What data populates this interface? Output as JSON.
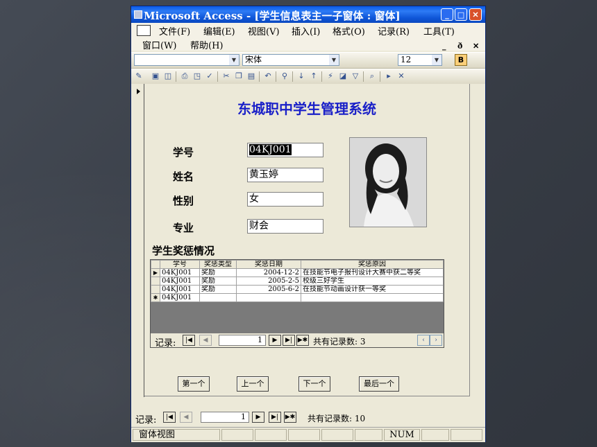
{
  "window": {
    "title": "Microsoft Access - [学生信息表主一子窗体 : 窗体]"
  },
  "menubar": {
    "items": [
      {
        "label": "文件(F)"
      },
      {
        "label": "编辑(E)"
      },
      {
        "label": "视图(V)"
      },
      {
        "label": "插入(I)"
      },
      {
        "label": "格式(O)"
      },
      {
        "label": "记录(R)"
      },
      {
        "label": "工具(T)"
      },
      {
        "label": "窗口(W)"
      },
      {
        "label": "帮助(H)"
      }
    ]
  },
  "format_toolbar": {
    "font": "宋体",
    "size": "12",
    "bold": "B"
  },
  "form": {
    "heading": "东城职中学生管理系统",
    "fields": [
      {
        "label": "学号",
        "value": "04KJ001"
      },
      {
        "label": "姓名",
        "value": "黄玉婷"
      },
      {
        "label": "性别",
        "value": "女"
      },
      {
        "label": "专业",
        "value": "财会"
      }
    ],
    "subform_title": "学生奖惩情况",
    "subform": {
      "columns": [
        "学号",
        "奖惩类型",
        "奖惩日期",
        "奖惩原因"
      ],
      "rows": [
        [
          "04KJ001",
          "奖励",
          "2004-12-2",
          "在技能节电子报刊设计大赛中获二等奖"
        ],
        [
          "04KJ001",
          "奖励",
          "2005-2-5",
          "校级三好学生"
        ],
        [
          "04KJ001",
          "奖励",
          "2005-6-2",
          "在技能节动画设计获一等奖"
        ],
        [
          "04KJ001",
          "",
          "",
          ""
        ]
      ],
      "nav": {
        "label": "记录:",
        "current": "1",
        "total_text": "共有记录数: 3"
      }
    },
    "buttons": {
      "first": "第一个",
      "prev": "上一个",
      "next": "下一个",
      "last": "最后一个"
    }
  },
  "main_nav": {
    "label": "记录:",
    "current": "1",
    "total_text": "共有记录数: 10"
  },
  "statusbar": {
    "view": "窗体视图",
    "num": "NUM"
  },
  "colors": {
    "title_blue": "#1a20c8",
    "titlebar": "#0a5ae8"
  }
}
